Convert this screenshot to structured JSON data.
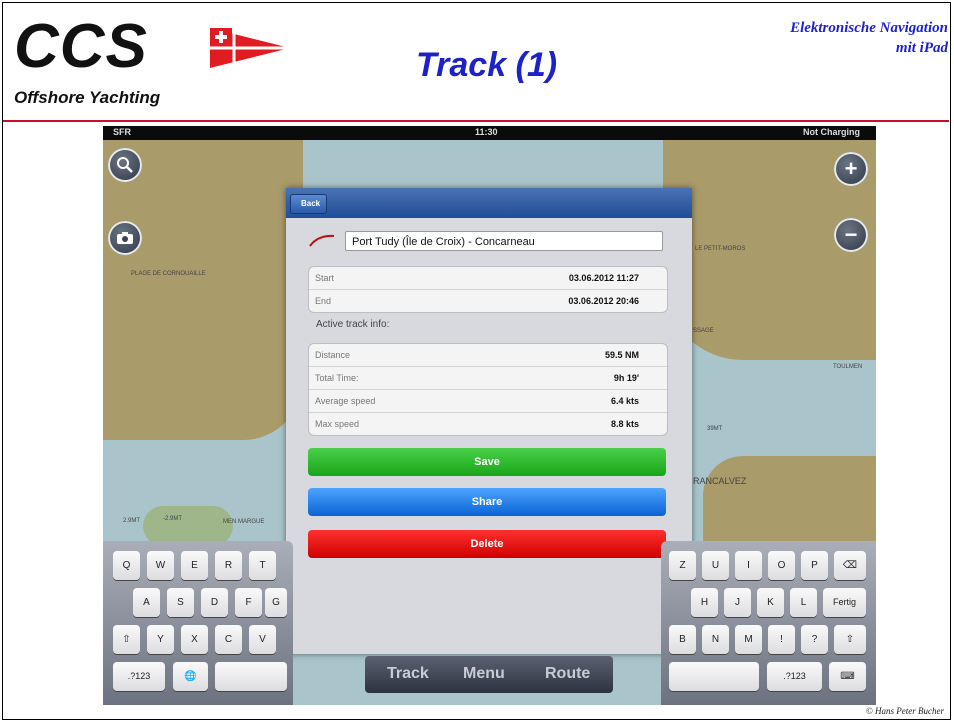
{
  "header": {
    "logo_text": "CCS",
    "logo_subtitle": "Offshore Yachting",
    "title": "Track (1)",
    "top_right_line1": "Elektronische Navigation",
    "top_right_line2": "mit iPad",
    "copyright": "© Hans Peter Bucher"
  },
  "statusbar": {
    "carrier": "SFR",
    "time": "11:30",
    "battery": "Not Charging"
  },
  "map": {
    "labels": [
      "PLAGE DE CORNOUAILLE",
      "LE PETIT-MOROS",
      "SSAGE",
      "TOULMEN",
      "39MT",
      "RANCALVEZ",
      "MEN MARGUE",
      "2.9MT",
      "-2.9MT"
    ]
  },
  "panel": {
    "back_label": "Back",
    "track_name": "Port Tudy (Île de Croix) - Concarneau",
    "times": [
      {
        "label": "Start",
        "value": "03.06.2012 11:27"
      },
      {
        "label": "End",
        "value": "03.06.2012 20:46"
      }
    ],
    "section_label": "Active track info:",
    "info": [
      {
        "label": "Distance",
        "value": "59.5 NM"
      },
      {
        "label": "Total Time:",
        "value": "9h 19'"
      },
      {
        "label": "Average speed",
        "value": "6.4 kts"
      },
      {
        "label": "Max speed",
        "value": "8.8 kts"
      }
    ],
    "save_label": "Save",
    "share_label": "Share",
    "delete_label": "Delete"
  },
  "keyboard": {
    "left_row1": [
      "Q",
      "W",
      "E",
      "R",
      "T"
    ],
    "left_row2": [
      "A",
      "S",
      "D",
      "F",
      "G"
    ],
    "left_row3": [
      "⇧",
      "Y",
      "X",
      "C",
      "V"
    ],
    "left_row4": [
      ".?123",
      "🌐",
      ""
    ],
    "right_row1": [
      "Z",
      "U",
      "I",
      "O",
      "P",
      "⌫"
    ],
    "right_row2": [
      "H",
      "J",
      "K",
      "L",
      "Fertig"
    ],
    "right_row3": [
      "B",
      "N",
      "M",
      "!",
      "?",
      "⇧"
    ],
    "right_row4": [
      "",
      ".?123",
      "⌨"
    ]
  },
  "toolbar": {
    "track": "Track",
    "menu": "Menu",
    "route": "Route"
  }
}
